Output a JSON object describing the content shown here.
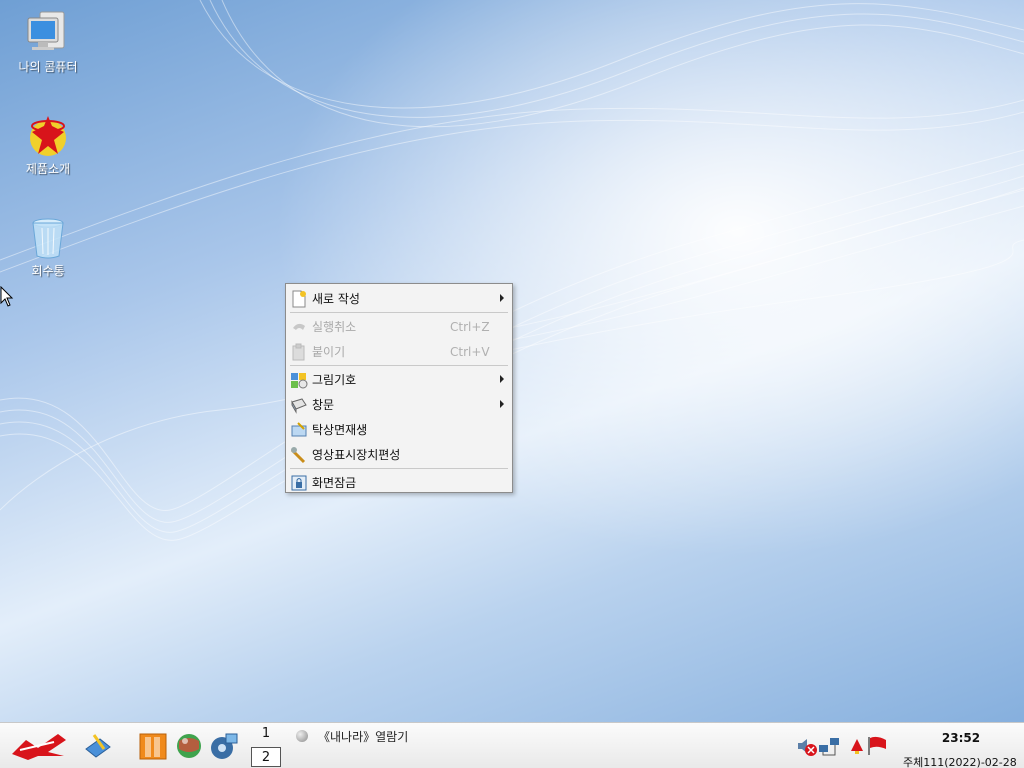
{
  "desktop": {
    "icons": [
      {
        "label": "나의 콤퓨터",
        "icon": "computer-icon"
      },
      {
        "label": "제품소개",
        "icon": "product-intro-icon"
      },
      {
        "label": "회수통",
        "icon": "recycle-bin-icon"
      }
    ]
  },
  "context_menu": {
    "items": [
      {
        "label": "새로 작성",
        "icon": "new-document-icon",
        "submenu": true,
        "enabled": true
      },
      {
        "label": "실행취소",
        "shortcut": "Ctrl+Z",
        "icon": "undo-icon",
        "enabled": false
      },
      {
        "label": "붙이기",
        "shortcut": "Ctrl+V",
        "icon": "paste-icon",
        "enabled": false
      },
      {
        "label": "그림기호",
        "icon": "icon-arrange-icon",
        "submenu": true,
        "enabled": true
      },
      {
        "label": "창문",
        "icon": "window-icon",
        "submenu": true,
        "enabled": true
      },
      {
        "label": "탁상면재생",
        "icon": "desktop-refresh-icon",
        "enabled": true
      },
      {
        "label": "영상표시장치편성",
        "icon": "display-settings-icon",
        "enabled": true
      },
      {
        "label": "화면잠금",
        "icon": "lock-screen-icon",
        "enabled": true
      }
    ]
  },
  "taskbar": {
    "workspaces": [
      "1",
      "2"
    ],
    "active_workspace": "2",
    "task_label": "《내나라》열람기",
    "clock_time": "23:52",
    "clock_date": "주체111(2022)-02-28"
  },
  "colors": {
    "wallpaper_blue": "#6f9fd4",
    "menu_background": "#f3f3f3",
    "taskbar_background": "#eeeeee",
    "flag_red": "#d8141b"
  }
}
